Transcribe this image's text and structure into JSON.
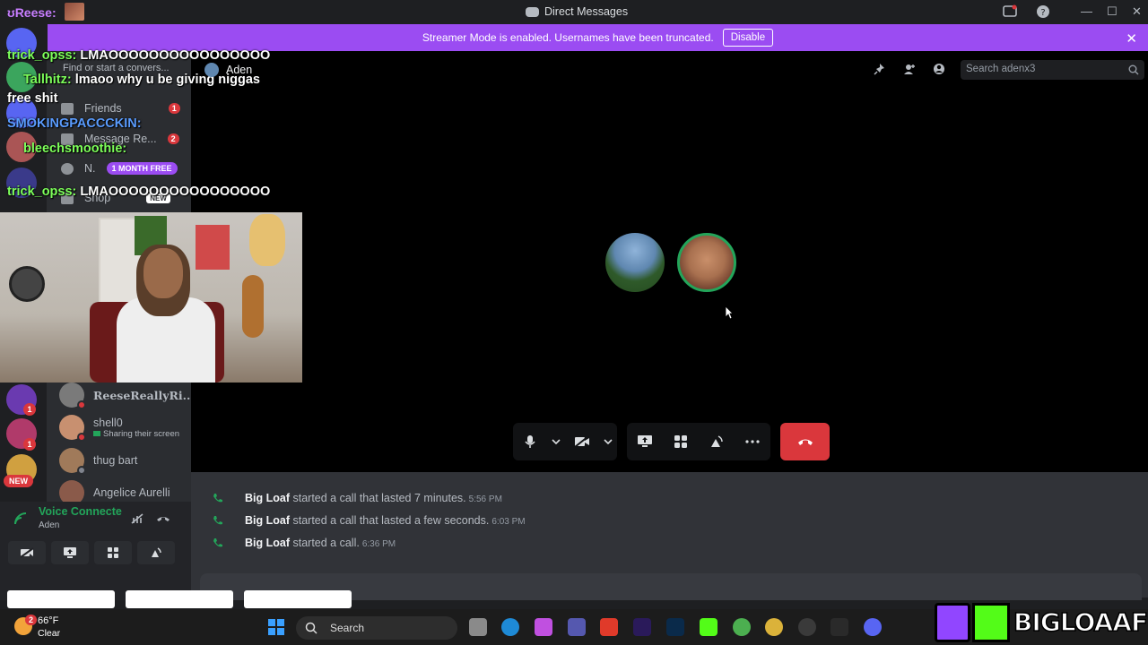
{
  "titlebar": {
    "user": "ʊReese:",
    "title": "Direct Messages",
    "minimize": "—",
    "maximize": "☐",
    "close": "✕"
  },
  "banner": {
    "text": "Streamer Mode is enabled. Usernames have been truncated.",
    "button": "Disable",
    "close": "✕"
  },
  "sidebar": {
    "search_placeholder": "Find or start a convers...",
    "items": [
      {
        "label": "Friends",
        "badge": "1"
      },
      {
        "label": "Message Re...",
        "badge": "2"
      },
      {
        "label": "N.",
        "pill": "1 MONTH FREE"
      },
      {
        "label": "Shop",
        "pill": "NEW"
      }
    ],
    "dms": [
      {
        "name": "ReeseReallyRi...",
        "sub": ""
      },
      {
        "name": "shell0",
        "sub": "Sharing their screen"
      },
      {
        "name": "thug bart",
        "sub": ""
      },
      {
        "name": "Angelice Aurelli",
        "sub": ""
      }
    ]
  },
  "rail": {
    "new_label": "NEW"
  },
  "voice": {
    "status": "Voice Connecte",
    "channel": "Aden"
  },
  "chat_overlay": [
    {
      "user": "trick_opss:",
      "text": "LMAOOOOOOOOOOOOOOOO"
    },
    {
      "user": "Tallhitz:",
      "text": "lmaoo why u be giving niggas"
    },
    {
      "user": "",
      "text": "free shit"
    },
    {
      "user": "SMOKINGPACCCKIN:",
      "text": ""
    },
    {
      "user": "bleechsmoothie:",
      "text": ""
    },
    {
      "user": "trick_opss:",
      "text": "LMAOOOOOOOOOOOOOOOO"
    }
  ],
  "header": {
    "dm_name": "Aden",
    "search_placeholder": "Search adenx3"
  },
  "messages": [
    {
      "who": "Big Loaf",
      "text": "started a call that lasted 7 minutes.",
      "time": "5:56 PM"
    },
    {
      "who": "Big Loaf",
      "text": "started a call that lasted a few seconds.",
      "time": "6:03 PM"
    },
    {
      "who": "Big Loaf",
      "text": "started a call.",
      "time": "6:36 PM"
    }
  ],
  "taskbar": {
    "temp": "66°F",
    "cond": "Clear",
    "search": "Search",
    "weather_badge": "2"
  },
  "watermark": {
    "text": "BIGLOAAF"
  },
  "colors": {
    "accent": "#9b4cf2",
    "danger": "#da373c",
    "online": "#23a55a",
    "kick": "#53fc18",
    "twitch": "#9146ff"
  }
}
